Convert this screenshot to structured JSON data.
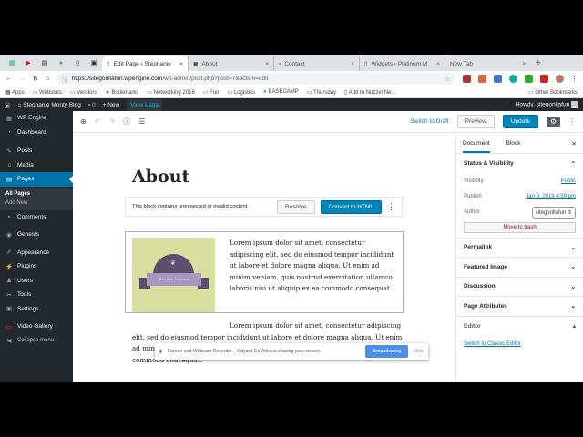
{
  "browser": {
    "tabs": [
      {
        "title": "Edit Page ‹ Stephanie",
        "active": true
      },
      {
        "title": "About"
      },
      {
        "title": "Contact"
      },
      {
        "title": "Widgets ‹ Platinum M"
      },
      {
        "title": "New Tab"
      }
    ],
    "url_host": "https://sitegorillafun.wpengine.com",
    "url_path": "/wp-admin/post.php?post=7&action=edit",
    "bookmarks": [
      "Apps",
      "Webstats",
      "Vendors",
      "Bookmarks",
      "Networking 2016",
      "Fun",
      "Logistics",
      "BASECAMP",
      "Thursday",
      "Add to Nuzzel Ne..."
    ],
    "other_bookmarks": "Other Bookmarks"
  },
  "adminbar": {
    "site": "Stephanie Monty Blog",
    "comments": "0",
    "new": "New",
    "view": "View Page",
    "howdy": "Howdy, sitegorillafun"
  },
  "sidebar": {
    "items": [
      "WP Engine",
      "Dashboard",
      "Posts",
      "Media",
      "Pages",
      "Comments",
      "Genesis",
      "Appearance",
      "Plugins",
      "Users",
      "Tools",
      "Settings",
      "Video Gallery",
      "Collapse menu"
    ],
    "sub": [
      "All Pages",
      "Add New"
    ]
  },
  "toolbar": {
    "switch_draft": "Switch to Draft",
    "preview": "Preview",
    "update": "Update"
  },
  "editor": {
    "title": "About",
    "warning": "This block contains unexpected or invalid content.",
    "resolve": "Resolve",
    "convert": "Convert to HTML",
    "image_text": "Best New Gardenias",
    "block_text": "Lorem ipsum dolor sit amet, consectetur adipiscing elit, sed do eiusmod tempor incididunt ut labore et dolore magna aliqua. Ut enim ad minim veniam, quis nostrud exercitation ullamco laboris nisi ut aliquip ex ea commodo consequat",
    "para_text": "Lorem ipsum dolor sit amet, consectetur adipiscing elit, sed do eiusmod tempor incididunt ut labore et dolore magna aliqua. Ut enim ad minim veniam, quis nostrud exercitation ullamco laboris nisi ut aliquip ex ea commodo consequat."
  },
  "share": {
    "text": "Screen and Webcam Recorder - Vidyard GoVideo is sharing your screen.",
    "stop": "Stop sharing",
    "hide": "Hide"
  },
  "panel": {
    "tab_doc": "Document",
    "tab_block": "Block",
    "status": "Status & Visibility",
    "visibility_label": "Visibility",
    "visibility": "Public",
    "publish_label": "Publish",
    "publish": "Jan 9, 2019 4:59 pm",
    "author_label": "Author",
    "author": "sitegorillafun",
    "trash": "Move to trash",
    "sections": [
      "Permalink",
      "Featured Image",
      "Discussion",
      "Page Attributes"
    ],
    "editor": "Editor",
    "classic": "Switch to Classic Editor"
  }
}
